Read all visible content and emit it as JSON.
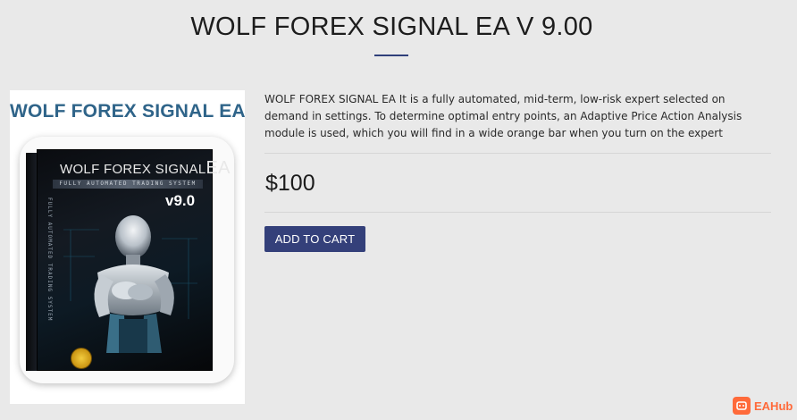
{
  "page": {
    "title": "WOLF FOREX SIGNAL EA V 9.00",
    "accent_color": "#34407a"
  },
  "product": {
    "image": {
      "banner_text": "WOLF FOREX SIGNAL EA",
      "box_title": "WOLF FOREX SIGNAL",
      "box_title_big": "EA",
      "box_subtitle": "FULLY AUTOMATED TRADING SYSTEM",
      "box_side_text": "FULLY AUTOMATED TRADING SYSTEM",
      "box_version": "v9.0"
    },
    "description": "WOLF FOREX SIGNAL EA It is a fully automated, mid-term, low-risk expert selected on demand in settings. To determine optimal entry points, an Adaptive Price Action Analysis module is used, which you will find in a wide orange bar when you turn on the expert",
    "price": "$100",
    "add_to_cart_label": "ADD TO CART"
  },
  "watermark": {
    "text": "EAHub",
    "color": "#ff6a3a",
    "icon": "eahub-logo-icon"
  }
}
